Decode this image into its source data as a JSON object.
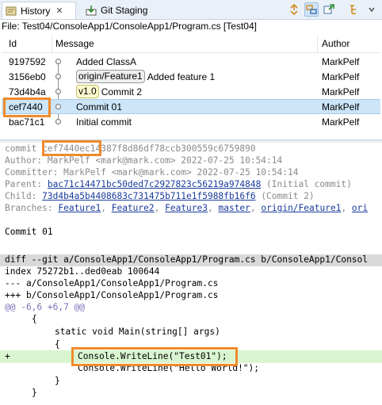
{
  "tabs": {
    "history": "History",
    "history_close": "✕",
    "git_staging": "Git Staging"
  },
  "toolbar_icons": [
    "sync-icon",
    "link-with-selection-icon",
    "compare-mode-icon",
    "filter-icon",
    "menu-icon"
  ],
  "file_line": "File: Test04/ConsoleApp1/ConsoleApp1/Program.cs [Test04]",
  "table": {
    "headers": {
      "id": "Id",
      "message": "Message",
      "author": "Author"
    },
    "rows": [
      {
        "id": "9197592",
        "refs": [],
        "message": "Added ClassA",
        "author": "MarkPelf"
      },
      {
        "id": "3156eb0",
        "refs": [
          {
            "label": "origin/Feature1",
            "kind": "remote"
          }
        ],
        "message": "Added feature 1",
        "author": "MarkPelf"
      },
      {
        "id": "73d4b4a",
        "refs": [
          {
            "label": "v1.0",
            "kind": "tag"
          }
        ],
        "message": "Commit 2",
        "author": "MarkPelf"
      },
      {
        "id": "cef7440",
        "refs": [],
        "message": "Commit 01",
        "author": "MarkPelf",
        "selected": true
      },
      {
        "id": "bac71c1",
        "refs": [],
        "message": "Initial commit",
        "author": "MarkPelf"
      }
    ]
  },
  "detail": {
    "commit_label": "commit ",
    "commit_hash": "cef7440ec14387f8d86df78ccb300559c6759890",
    "author_line": "Author: MarkPelf <mark@mark.com> 2022-07-25 10:54:14",
    "committer_line": "Committer: MarkPelf <mark@mark.com> 2022-07-25 10:54:14",
    "parent_label": "Parent: ",
    "parent_hash": "bac71c14471bc50ded7c2927823c56219a974848",
    "parent_note": " (Initial commit)",
    "child_label": "Child: ",
    "child_hash": "73d4b4a5b4408683c731475b711e1f5988fb16f6",
    "child_note": " (Commit 2)",
    "branches_label": "Branches: ",
    "branches": [
      "Feature1",
      "Feature2",
      "Feature3",
      "master",
      "origin/Feature1",
      "ori"
    ],
    "message": "Commit 01",
    "diff_header": "diff --git a/ConsoleApp1/ConsoleApp1/Program.cs b/ConsoleApp1/Consol",
    "index_line": "index 75272b1..ded0eab 100644",
    "minus_line": "--- a/ConsoleApp1/ConsoleApp1/Program.cs",
    "plus_line": "+++ b/ConsoleApp1/ConsoleApp1/Program.cs",
    "hunk_line": "@@ -6,6 +6,7 @@",
    "code": [
      {
        "marker": "",
        "text": "{"
      },
      {
        "marker": "",
        "text": "static void Main(string[] args)"
      },
      {
        "marker": "",
        "text": "{"
      },
      {
        "marker": "+",
        "text": "Console.WriteLine(\"Test01\");"
      },
      {
        "marker": "",
        "text": "Console.WriteLine(\"Hello World!\");"
      },
      {
        "marker": "",
        "text": "}"
      },
      {
        "marker": "",
        "text": "}"
      }
    ]
  },
  "highlight_color": "#f08a2c"
}
